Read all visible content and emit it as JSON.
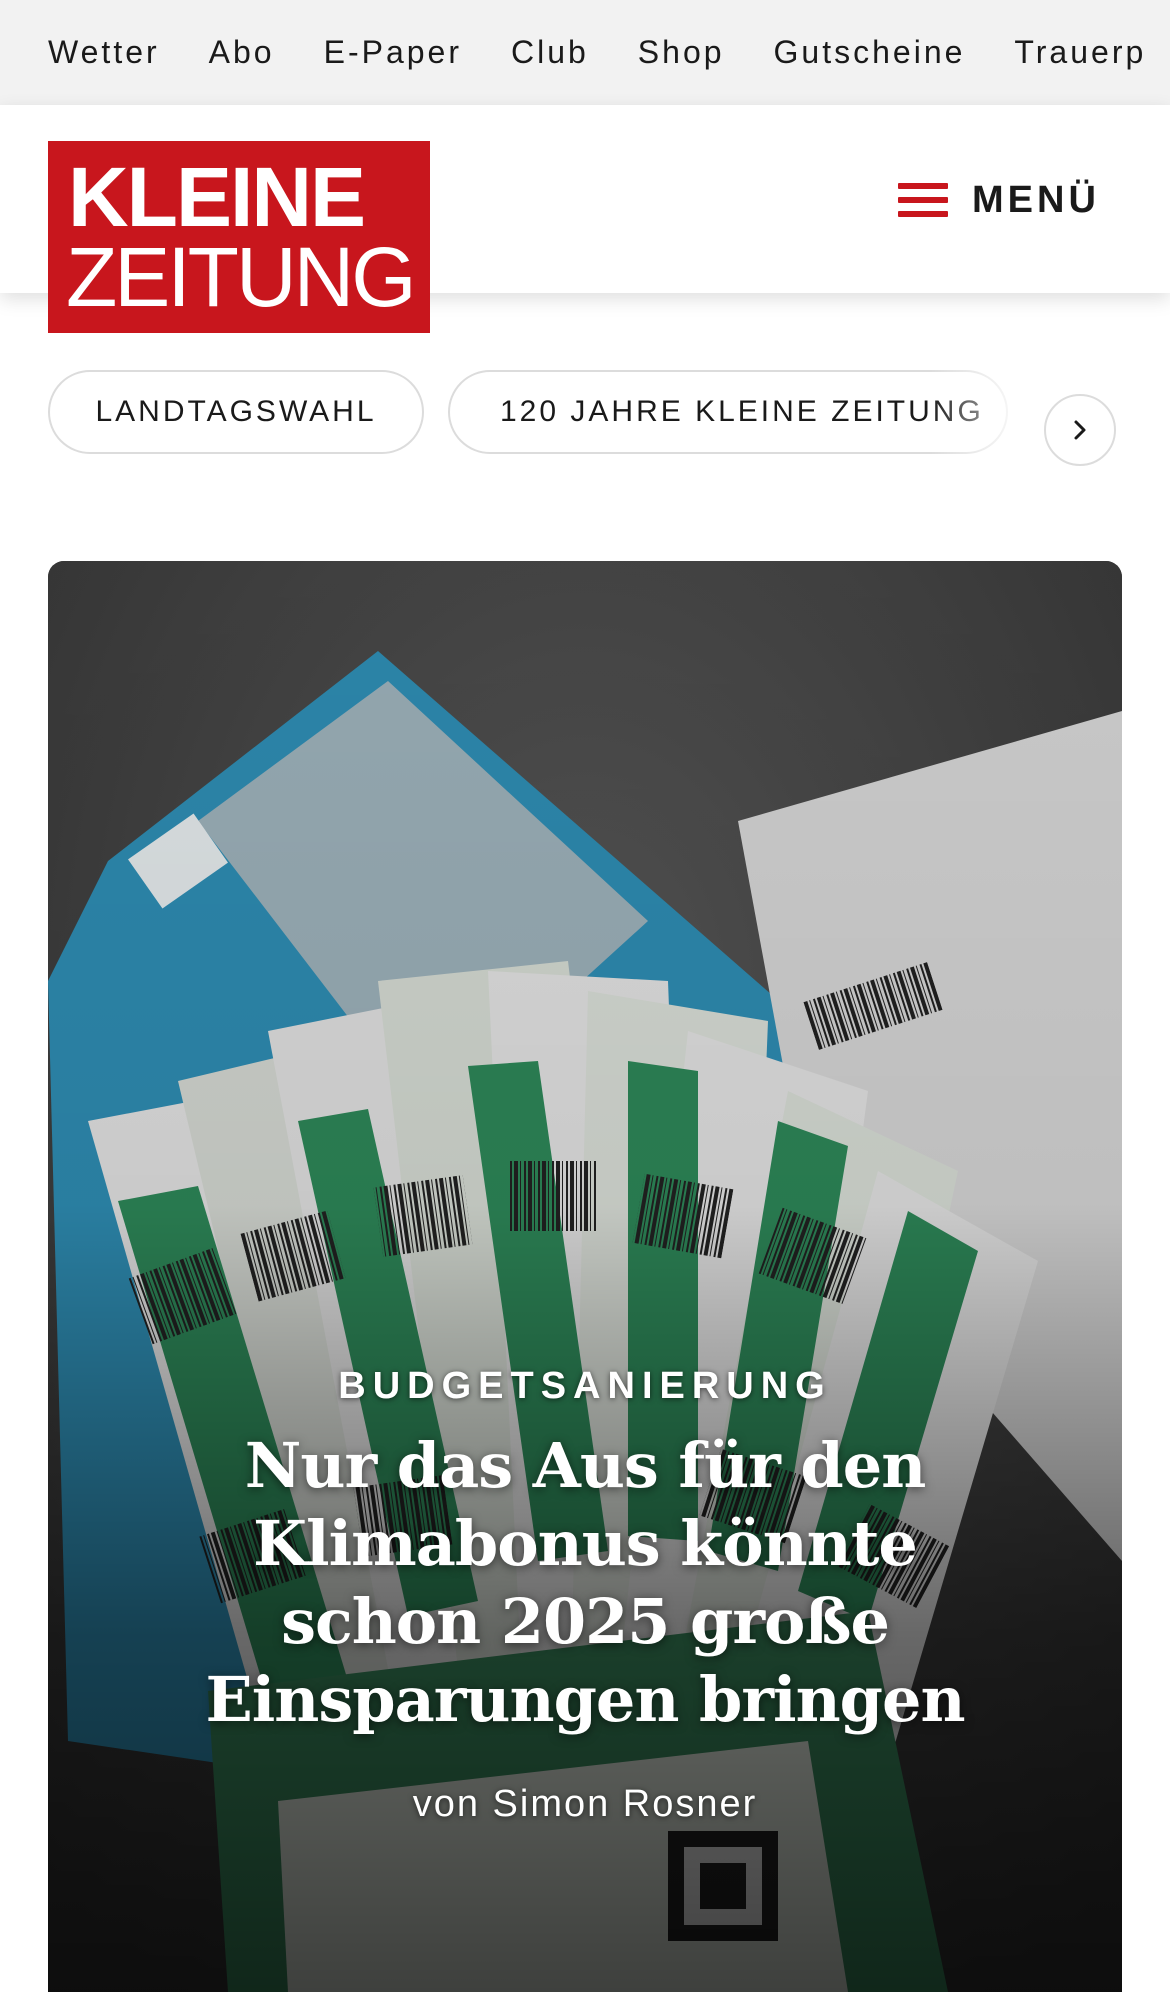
{
  "topbar": {
    "links": [
      "Wetter",
      "Abo",
      "E-Paper",
      "Club",
      "Shop",
      "Gutscheine",
      "Trauerp"
    ]
  },
  "header": {
    "logo_line1": "KLEINE",
    "logo_line2": "ZEITUNG",
    "menu_label": "MENÜ",
    "brand_color": "#c8161d"
  },
  "chips": {
    "items": [
      "LANDTAGSWAHL",
      "120 JAHRE KLEINE ZEITUNG"
    ],
    "next_icon": "chevron-right-icon"
  },
  "hero": {
    "kicker": "BUDGETSANIERUNG",
    "title": "Nur das Aus für den Klimabonus könnte schon 2025 große Einsparungen bringen",
    "author": "von Simon Rosner"
  }
}
